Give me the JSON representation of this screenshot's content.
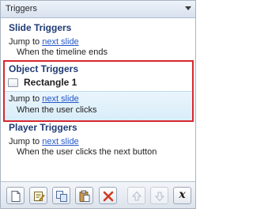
{
  "panel": {
    "title": "Triggers"
  },
  "slide_triggers": {
    "heading": "Slide Triggers",
    "action_prefix": "Jump to",
    "action_link": "next slide",
    "condition": "When the timeline ends"
  },
  "object_triggers": {
    "heading": "Object Triggers",
    "object_name": "Rectangle 1",
    "action_prefix": "Jump to",
    "action_link": "next slide",
    "condition": "When the user clicks"
  },
  "player_triggers": {
    "heading": "Player Triggers",
    "action_prefix": "Jump to",
    "action_link": "next slide",
    "condition": "When the user clicks the next button"
  },
  "toolbar": {
    "buttons": [
      {
        "icon": "new-trigger-icon",
        "enabled": true
      },
      {
        "icon": "edit-trigger-icon",
        "enabled": true
      },
      {
        "icon": "copy-trigger-icon",
        "enabled": true
      },
      {
        "icon": "paste-trigger-icon",
        "enabled": true
      },
      {
        "icon": "delete-trigger-icon",
        "enabled": true
      },
      {
        "icon": "move-up-icon",
        "enabled": false
      },
      {
        "icon": "move-down-icon",
        "enabled": false
      },
      {
        "icon": "variables-icon",
        "enabled": true,
        "glyph": "x"
      }
    ]
  },
  "colors": {
    "heading": "#1f3b73",
    "link": "#2458c8",
    "selection_border": "#d7282f",
    "selected_action_bg": "#e1f1fb"
  }
}
